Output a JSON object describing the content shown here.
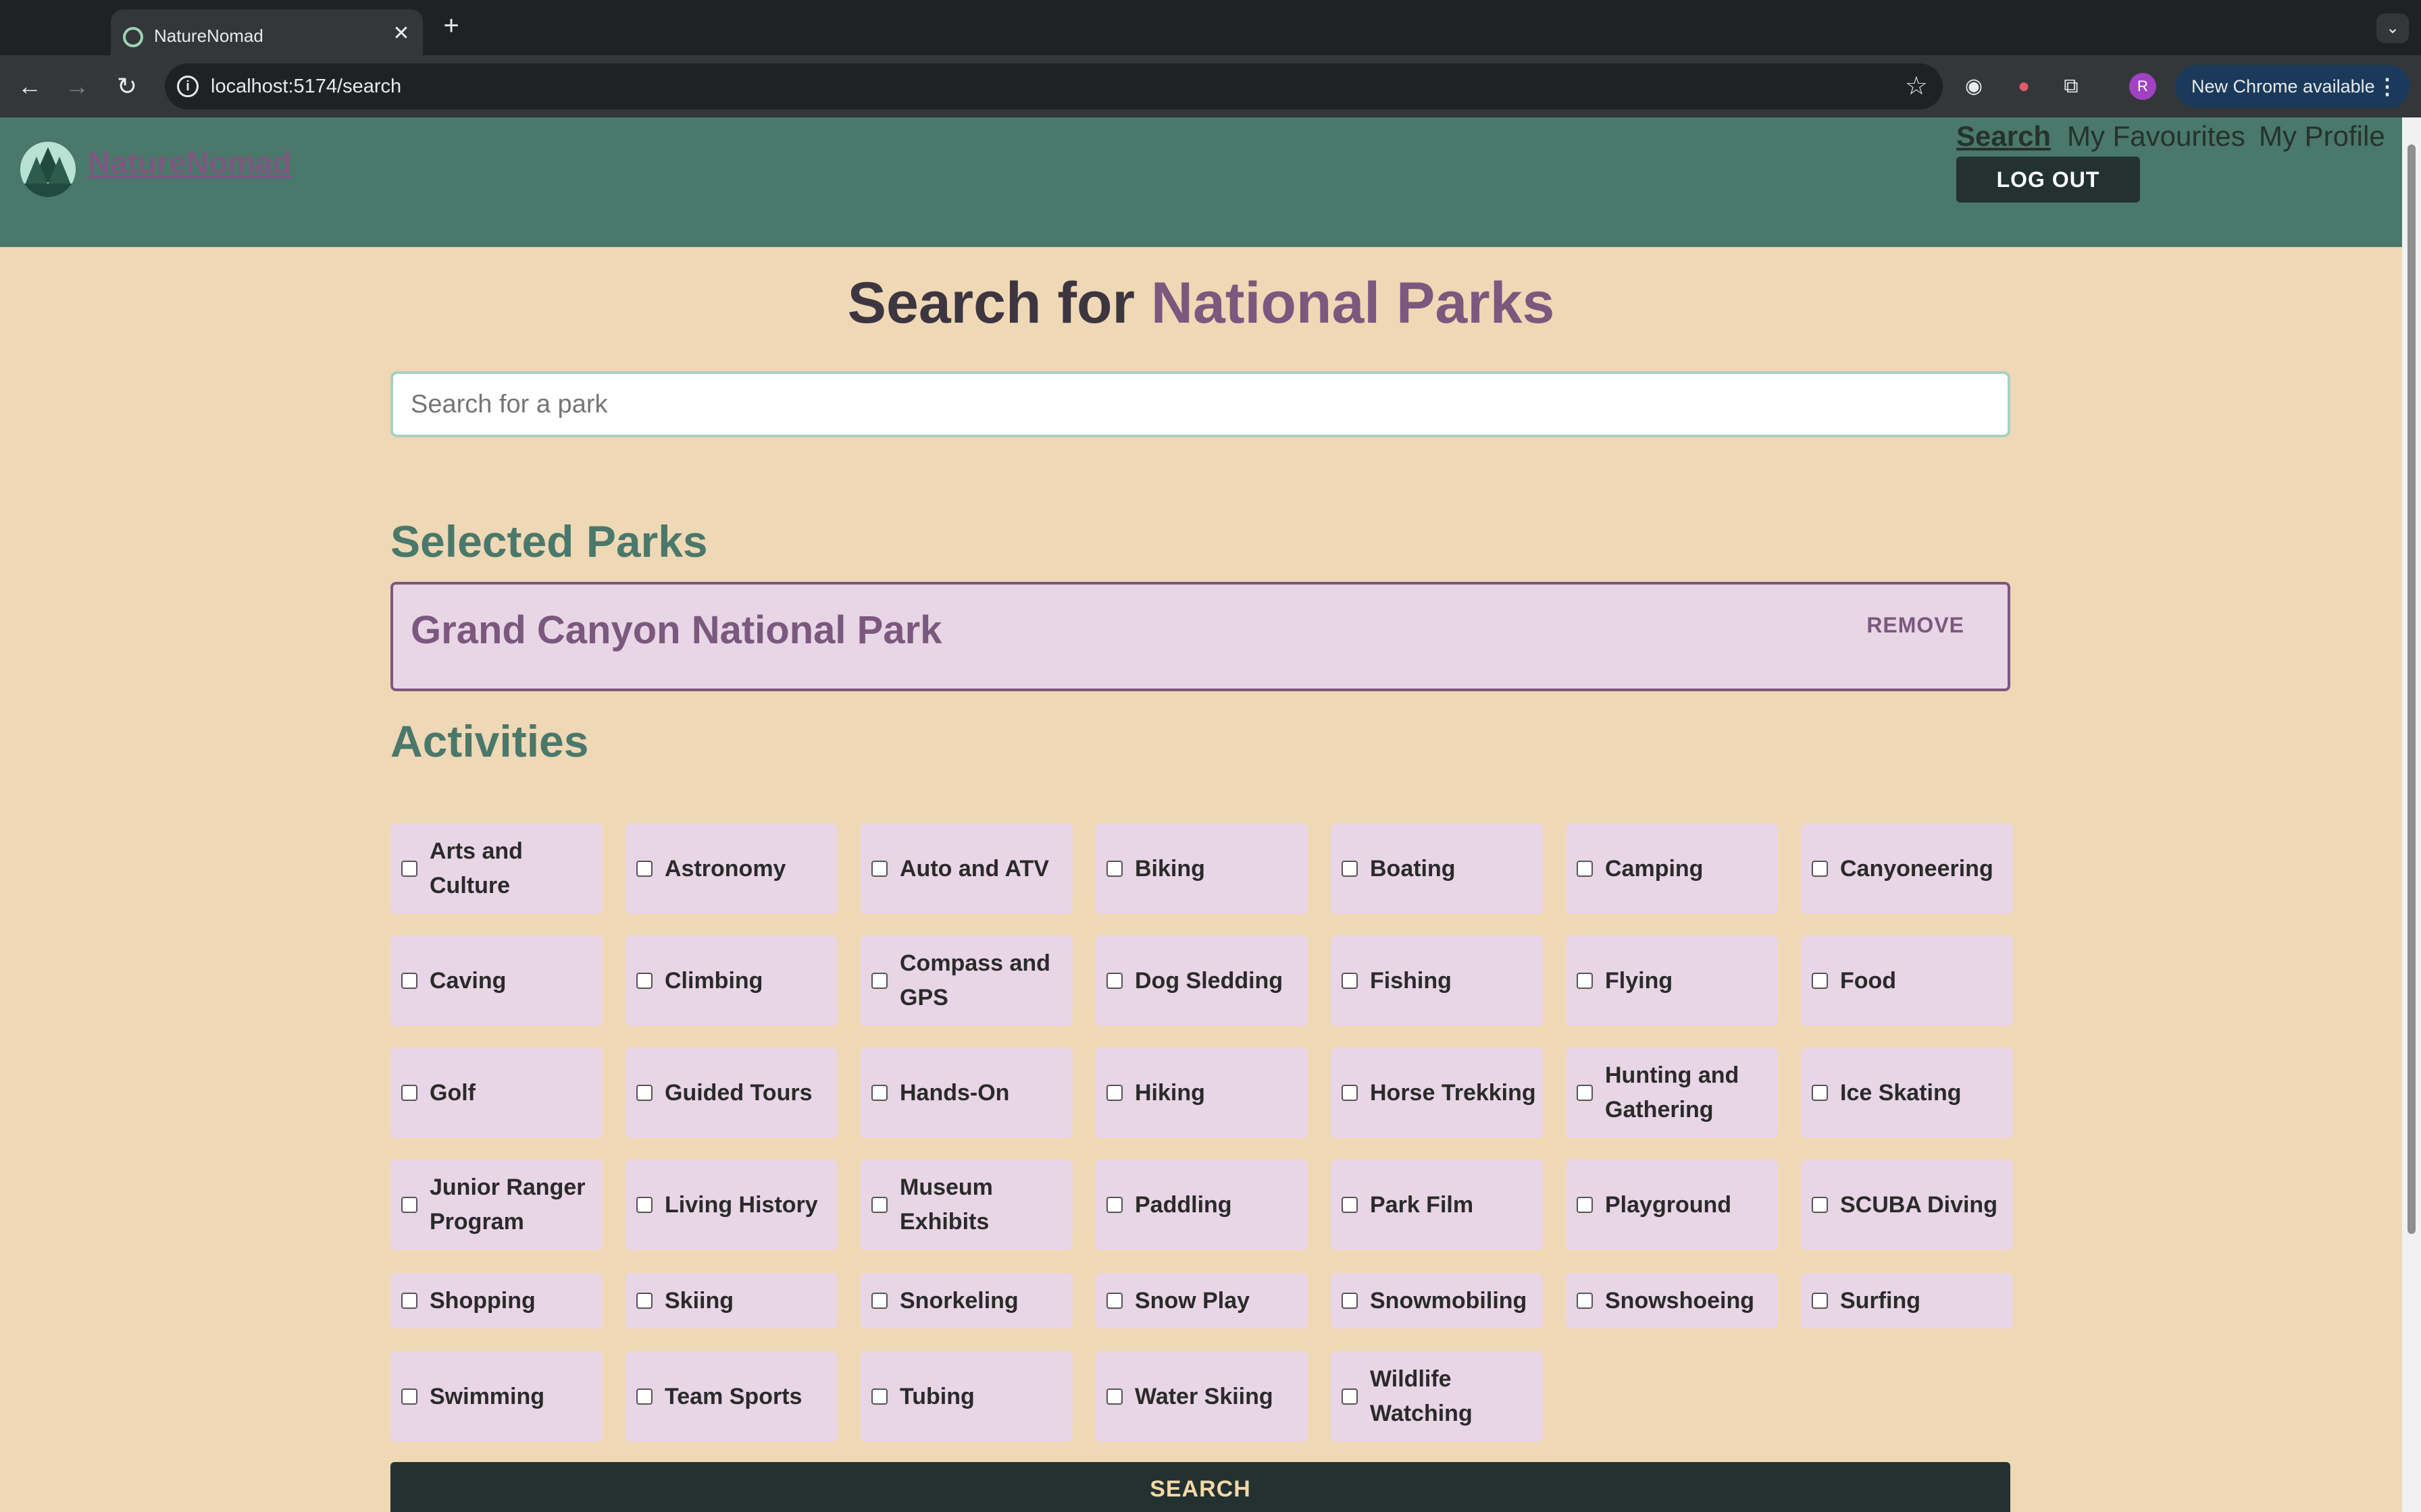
{
  "browser": {
    "tab_title": "NatureNomad",
    "url": "localhost:5174/search",
    "profile_initial": "R",
    "update_label": "New Chrome available"
  },
  "header": {
    "brand": "NatureNomad",
    "nav": [
      "Search",
      "My Favourites",
      "My Profile"
    ],
    "logout_label": "LOG OUT"
  },
  "main": {
    "title_prefix": "Search for ",
    "title_accent": "National Parks",
    "search_placeholder": "Search for a park",
    "selected_heading": "Selected Parks",
    "selected_parks": [
      {
        "name": "Grand Canyon National Park",
        "remove_label": "REMOVE"
      }
    ],
    "activities_heading": "Activities",
    "activities": [
      "Arts and Culture",
      "Astronomy",
      "Auto and ATV",
      "Biking",
      "Boating",
      "Camping",
      "Canyoneering",
      "Caving",
      "Climbing",
      "Compass and GPS",
      "Dog Sledding",
      "Fishing",
      "Flying",
      "Food",
      "Golf",
      "Guided Tours",
      "Hands-On",
      "Hiking",
      "Horse Trekking",
      "Hunting and Gathering",
      "Ice Skating",
      "Junior Ranger Program",
      "Living History",
      "Museum Exhibits",
      "Paddling",
      "Park Film",
      "Playground",
      "SCUBA Diving",
      "Shopping",
      "Skiing",
      "Snorkeling",
      "Snow Play",
      "Snowmobiling",
      "Snowshoeing",
      "Surfing",
      "Swimming",
      "Team Sports",
      "Tubing",
      "Water Skiing",
      "Wildlife Watching"
    ],
    "search_button_label": "SEARCH"
  },
  "colors": {
    "header_bg": "#4a786b",
    "page_bg": "#efd8b5",
    "accent_purple": "#7b587e",
    "card_bg": "#e8d5e6",
    "dark_button": "#243131"
  }
}
